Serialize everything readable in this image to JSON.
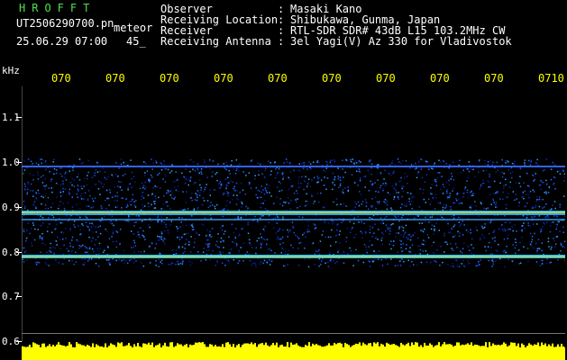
{
  "header": {
    "brand": "HROFFT",
    "filename": "UT2506290700.pn",
    "mode": "meteor",
    "datetime": "25.06.29 07:00",
    "seconds": "45_"
  },
  "metadata": [
    {
      "label": "Observer",
      "value": "Masaki Kano"
    },
    {
      "label": "Receiving Location",
      "value": "Shibukawa, Gunma, Japan"
    },
    {
      "label": "Receiver",
      "value": "RTL-SDR SDR# 43dB L15 103.2MHz CW"
    },
    {
      "label": "Receiving Antenna",
      "value": "3el Yagi(V) Az 330 for Vladivostok"
    }
  ],
  "axis": {
    "unit": "kHz",
    "x_ticks": [
      "070",
      "070",
      "070",
      "070",
      "070",
      "070",
      "070",
      "070",
      "070",
      "0710"
    ],
    "y_ticks": [
      "1.1",
      "1.0",
      "0.9",
      "0.8",
      "0.7",
      "0.6"
    ]
  },
  "colors": {
    "brand": "#4fe04f",
    "ticks": "#ffff00",
    "signal": "#ffff00"
  }
}
